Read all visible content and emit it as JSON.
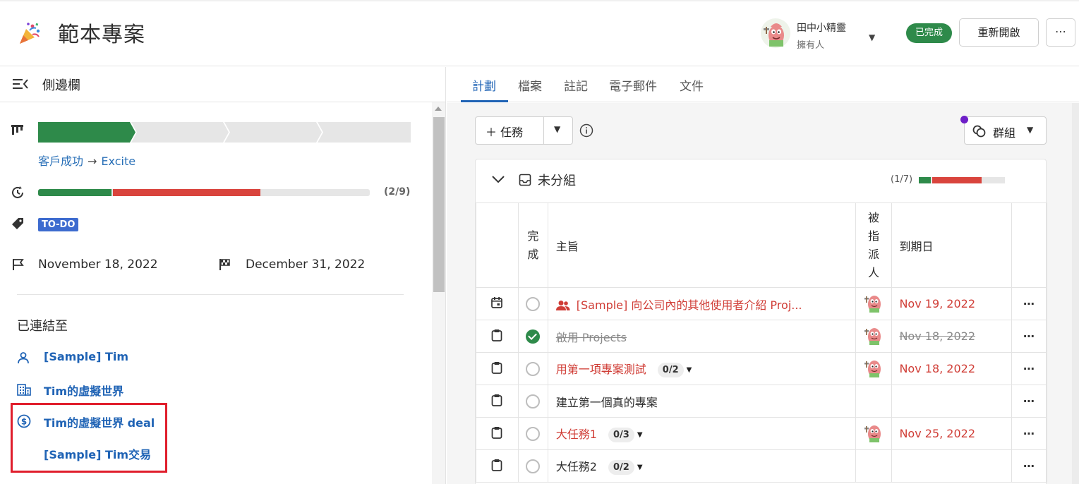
{
  "header": {
    "project_title": "範本專案",
    "owner_name": "田中小精靈",
    "owner_role": "擁有人",
    "status_badge": "已完成",
    "reopen_label": "重新開啟",
    "more_label": "⋯"
  },
  "sidebar": {
    "title": "側邊欄",
    "stage_from": "客戶成功",
    "stage_to": "Excite",
    "stage_count": 4,
    "stage_current": 1,
    "task_progress_label": "(2/9)",
    "task_progress_done_fraction": 0.222,
    "task_progress_overdue_fraction": 0.444,
    "label_tag": "TO-DO",
    "start_date": "November 18, 2022",
    "end_date": "December 31, 2022",
    "linked_title": "已連結至",
    "linked_items": [
      {
        "icon": "person-icon",
        "label": "[Sample] Tim"
      },
      {
        "icon": "building-icon",
        "label": "Tim的虛擬世界"
      },
      {
        "icon": "dollar-circle-icon",
        "label": "Tim的虛擬世界 deal"
      },
      {
        "icon": "",
        "label": "[Sample] Tim交易"
      }
    ]
  },
  "tabs": [
    {
      "label": "計劃",
      "active": true
    },
    {
      "label": "檔案",
      "active": false
    },
    {
      "label": "註記",
      "active": false
    },
    {
      "label": "電子郵件",
      "active": false
    },
    {
      "label": "文件",
      "active": false
    }
  ],
  "toolbar": {
    "add_task_label": "任務",
    "group_label": "群組"
  },
  "group": {
    "title": "未分組",
    "count_label": "(1/7)",
    "done_fraction": 0.143,
    "overdue_fraction": 0.571
  },
  "table": {
    "headers": {
      "done": "完成",
      "subject": "主旨",
      "assignee": "被指派人",
      "due": "到期日"
    },
    "rows": [
      {
        "type_icon": "calendar-icon",
        "done": false,
        "subject": "[Sample] 向公司內的其他使用者介紹 Proj...",
        "subject_icon": "users-icon",
        "subtasks": "",
        "has_assignee": true,
        "due": "Nov 19, 2022",
        "status": "overdue"
      },
      {
        "type_icon": "clipboard-icon",
        "done": true,
        "subject": "啟用 Projects",
        "subject_icon": "",
        "subtasks": "",
        "has_assignee": true,
        "due": "Nov 18, 2022",
        "status": "done"
      },
      {
        "type_icon": "clipboard-icon",
        "done": false,
        "subject": "用第一項專案測試",
        "subject_icon": "",
        "subtasks": "0/2",
        "has_assignee": true,
        "due": "Nov 18, 2022",
        "status": "overdue"
      },
      {
        "type_icon": "clipboard-icon",
        "done": false,
        "subject": "建立第一個真的專案",
        "subject_icon": "",
        "subtasks": "",
        "has_assignee": false,
        "due": "",
        "status": "normal"
      },
      {
        "type_icon": "clipboard-icon",
        "done": false,
        "subject": "大任務1",
        "subject_icon": "",
        "subtasks": "0/3",
        "has_assignee": true,
        "due": "Nov 25, 2022",
        "status": "overdue"
      },
      {
        "type_icon": "clipboard-icon",
        "done": false,
        "subject": "大任務2",
        "subject_icon": "",
        "subtasks": "0/2",
        "has_assignee": false,
        "due": "",
        "status": "normal"
      }
    ]
  },
  "colors": {
    "green": "#2e8a4a",
    "red": "#d9443d",
    "blue": "#1f63b5",
    "tag_blue": "#3d6bcf",
    "highlight": "#e01e2c"
  }
}
